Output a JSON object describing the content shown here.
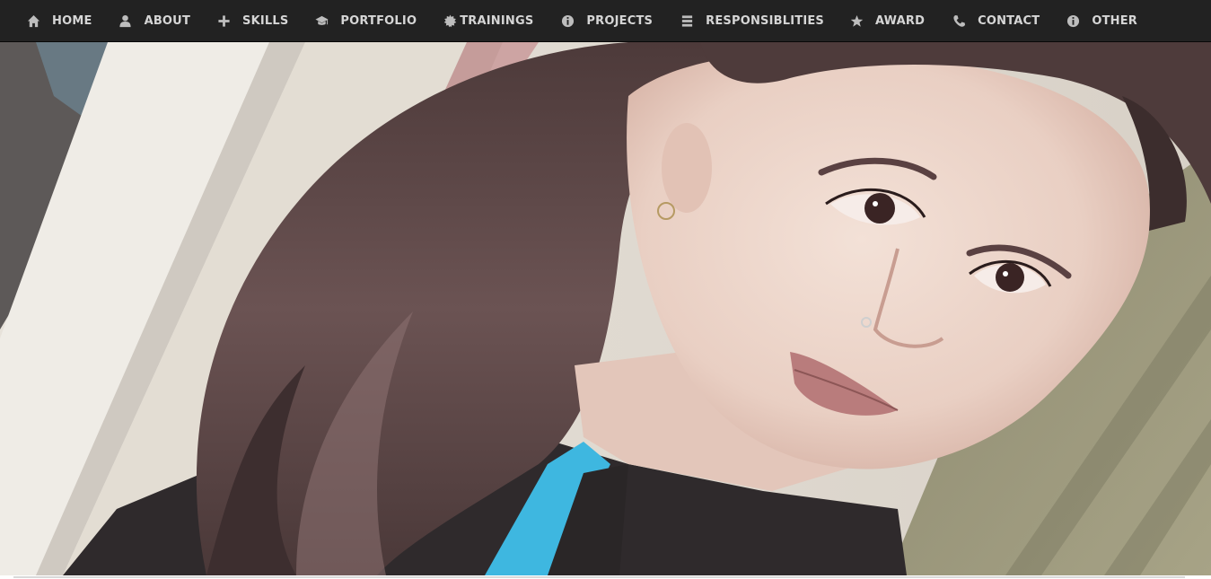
{
  "nav": {
    "items": [
      {
        "label": "Home",
        "icon": "home-icon"
      },
      {
        "label": "About",
        "icon": "user-icon"
      },
      {
        "label": "Skills",
        "icon": "plus-icon"
      },
      {
        "label": "Portfolio",
        "icon": "graduation-cap-icon"
      },
      {
        "label": "Trainings",
        "icon": "certificate-icon"
      },
      {
        "label": "Projects",
        "icon": "info-circle-icon"
      },
      {
        "label": "Responsiblities",
        "icon": "list-icon"
      },
      {
        "label": "Award",
        "icon": "star-icon"
      },
      {
        "label": "Contact",
        "icon": "phone-icon"
      },
      {
        "label": "Other",
        "icon": "info-circle-icon"
      }
    ]
  },
  "hero": {
    "image": "profile-portrait-photo"
  },
  "colors": {
    "navbar_bg": "#222222",
    "nav_text": "#d6d6d6"
  }
}
